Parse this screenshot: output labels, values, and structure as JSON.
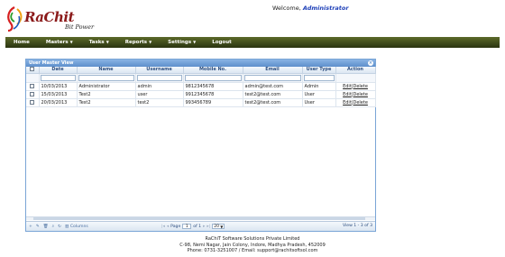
{
  "header": {
    "logo_text": "RaChit",
    "logo_tagline": "Bit Power",
    "welcome_prefix": "Welcome,",
    "welcome_user": "Administrator"
  },
  "nav": {
    "items": [
      {
        "label": "Home",
        "has_dropdown": false
      },
      {
        "label": "Masters",
        "has_dropdown": true
      },
      {
        "label": "Tasks",
        "has_dropdown": true
      },
      {
        "label": "Reports",
        "has_dropdown": true
      },
      {
        "label": "Settings",
        "has_dropdown": true
      },
      {
        "label": "Logout",
        "has_dropdown": false
      }
    ]
  },
  "grid": {
    "caption": "User Master View",
    "columns": [
      "Date",
      "Name",
      "Username",
      "Mobile No.",
      "Email",
      "User Type",
      "Action"
    ],
    "rows": [
      {
        "date": "10/03/2013",
        "name": "Administrator",
        "username": "admin",
        "mobile": "9812345678",
        "email": "admin@test.com",
        "user_type": "Admin"
      },
      {
        "date": "15/03/2013",
        "name": "Test2",
        "username": "user",
        "mobile": "9912345678",
        "email": "test2@test.com",
        "user_type": "User"
      },
      {
        "date": "20/03/2013",
        "name": "Test2",
        "username": "test2",
        "mobile": "993456789",
        "email": "test2@test.com",
        "user_type": "User"
      }
    ],
    "action_edit": "Edit",
    "action_separator": "|",
    "action_delete": "Delete",
    "pager": {
      "columns_label": "Columns",
      "page_label": "Page",
      "page_value": "1",
      "of_label": "of 1",
      "page_size": "20",
      "view_text": "View 1 - 3 of 3"
    }
  },
  "footer": {
    "company": "RaChiT Software Solutions Private Limited",
    "address": "C-98, Nemi Nagar, Jain Colony, Indore, Madhya Pradesh, 452009",
    "contact": "Phone: 0731-3251007 / Email: support@rachitsoftsol.com"
  },
  "colors": {
    "nav_bar": "#3c4a18",
    "grid_header": "#5d8fcb",
    "brand_logo": "#8b1a1a",
    "welcome_user": "#1d3fb8"
  }
}
